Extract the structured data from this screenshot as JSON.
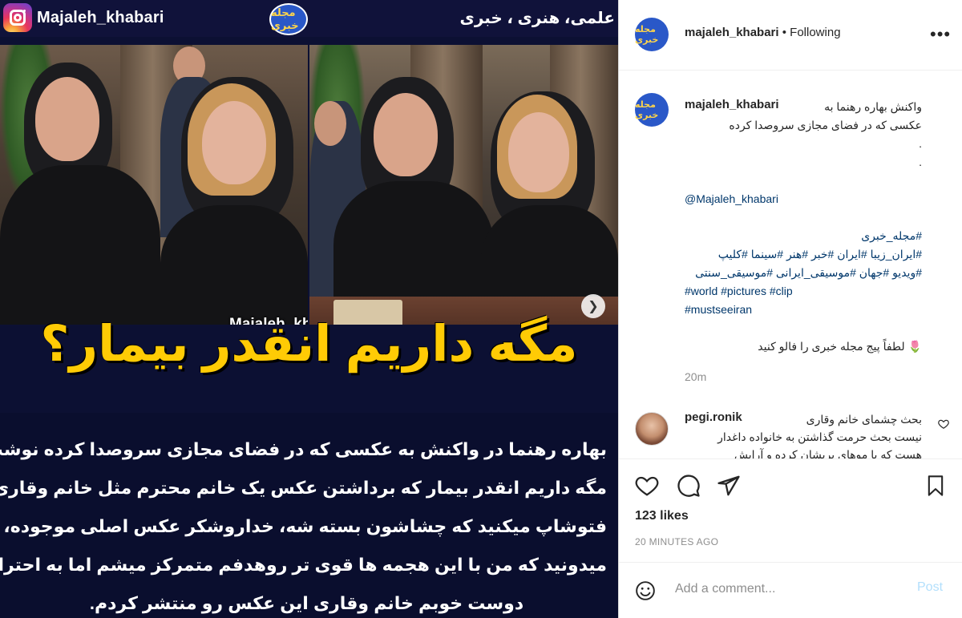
{
  "image": {
    "handle": "Majaleh_khabari",
    "brand_badge": "مجله خبری",
    "tagline": "علمی، هنری ، خبری",
    "watermark": "Majaleh_khabari",
    "headline": "مگه داریم انقدر بیمار؟",
    "caption_lines": [
      "بهاره رهنما در واکنش به عکسی که در فضای مجازی سروصدا کرده نوشت:",
      "مگه داریم انقدر بیمار که برداشتن عکس یک خانم محترم مثل خانم وقاری رو",
      "فتوشاپ میکنید که چشاشون بسته شه، خداروشکر عکس اصلی موجوده،",
      "میدونید که من با این هجمه ها قوی تر روهدفم متمرکز میشم اما به احترام",
      "دوست خوبم خانم وقاری این عکس رو منتشر کردم."
    ],
    "next_icon": "chevron-right-icon"
  },
  "header": {
    "username": "majaleh_khabari",
    "separator": "•",
    "follow_status": "Following",
    "more_icon": "more-icon"
  },
  "caption": {
    "username": "majaleh_khabari",
    "lines": [
      "واکنش بهاره رهنما به",
      "عکسی که در فضای مجازی سروصدا کرده",
      ".",
      ".",
      "",
      "@Majaleh_khabari",
      "",
      "#مجله_خبری",
      "#ایران_زیبا #ایران #خبر #هنر #سینما #کلیپ",
      "#ویدیو #جهان #موسیقی_ایرانی #موسیقی_سنتی",
      "#world #pictures #clip",
      "#mustseeiran",
      "",
      "🌷 لطفاً پیج مجله خبری را فالو کنید"
    ],
    "time_ago": "20m"
  },
  "comment": {
    "username": "pegi.ronik",
    "lines": [
      "بحث چشمای خانم وقاری",
      "نیست بحث حرمت گذاشتن به خانواده داغدار",
      "هست که با موهای پریشان کرده و آرایش"
    ]
  },
  "actions": {
    "likes": "123 likes",
    "post_time": "20 MINUTES AGO",
    "comment_placeholder": "Add a comment...",
    "post_label": "Post"
  },
  "colors": {
    "brand_blue": "#2a58c8",
    "headline_yellow": "#ffcb05",
    "image_bg": "#0c1033",
    "link": "#00376b",
    "post_disabled": "#b2dffc"
  }
}
